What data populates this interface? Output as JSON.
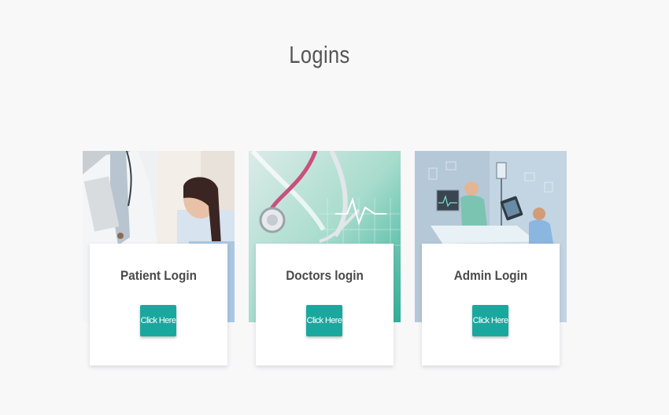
{
  "page": {
    "title": "Logins"
  },
  "cards": [
    {
      "title": "Patient Login",
      "button_label": "Click Here",
      "image": "doctor-with-patient-photo"
    },
    {
      "title": "Doctors login",
      "button_label": "Click Here",
      "image": "stethoscope-photo"
    },
    {
      "title": "Admin Login",
      "button_label": "Click Here",
      "image": "hospital-ward-illustration"
    }
  ],
  "colors": {
    "background": "#f8f8f9",
    "button": "#1aa89e",
    "button_text": "#ffffff",
    "card_title": "#4a4a4a",
    "page_title": "#555555"
  }
}
